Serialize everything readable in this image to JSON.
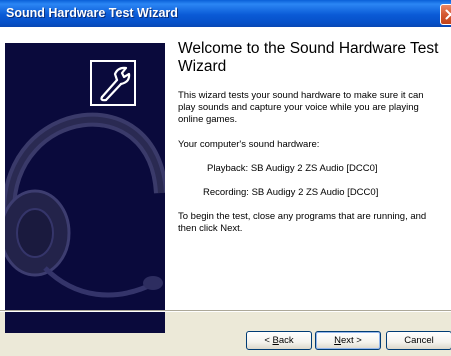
{
  "window": {
    "title": "Sound Hardware Test Wizard"
  },
  "main": {
    "heading": "Welcome to the Sound Hardware Test Wizard",
    "intro": "This wizard tests your sound hardware to make sure it can play sounds and capture your voice while you are playing online games.",
    "hardware_label": "Your computer's sound hardware:",
    "playback_label": "Playback:",
    "playback_device": "SB Audigy 2 ZS Audio [DCC0]",
    "recording_label": "Recording:",
    "recording_device": "SB Audigy 2 ZS Audio [DCC0]",
    "instructions": "To begin the test, close any programs that are running, and then click Next."
  },
  "buttons": {
    "back_prefix": "< ",
    "back_hotkey": "B",
    "back_rest": "ack",
    "next_hotkey": "N",
    "next_rest": "ext >",
    "cancel_label": "Cancel"
  },
  "icons": {
    "side_graphic": "headset-icon",
    "badge": "wrench-icon",
    "close": "close-icon"
  },
  "colors": {
    "titlebar": "#0a5ad6",
    "side_panel": "#0a0a3c",
    "close_button": "#d45a33"
  }
}
